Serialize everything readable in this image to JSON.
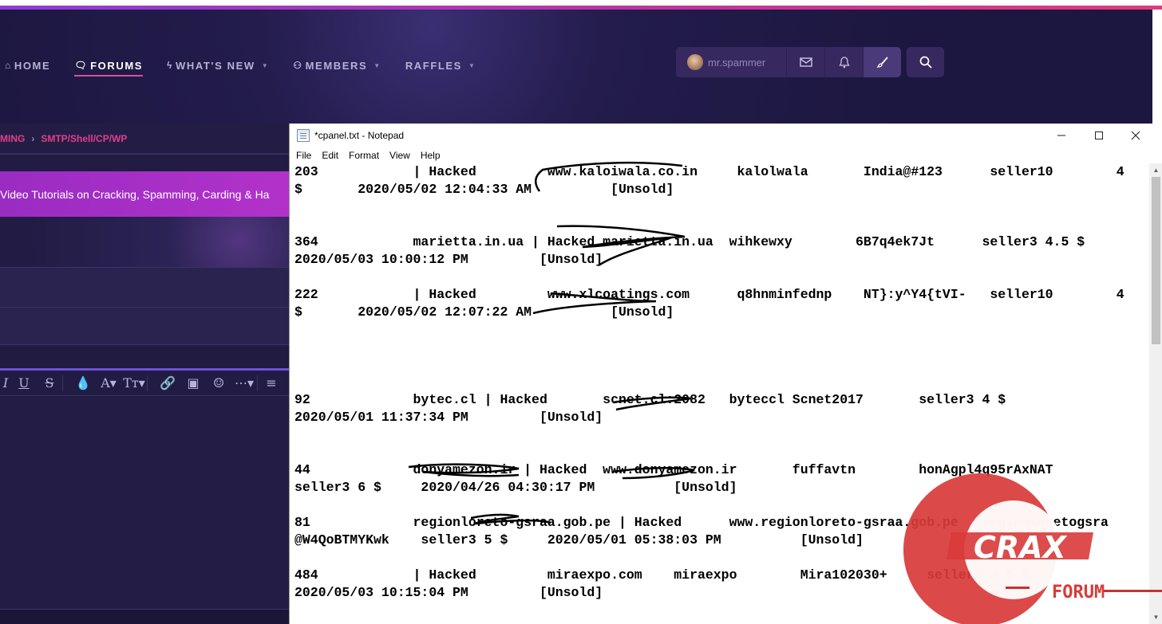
{
  "forum": {
    "nav": [
      {
        "label": "HOME",
        "icon": "home-icon"
      },
      {
        "label": "FORUMS",
        "icon": "forums-icon"
      },
      {
        "label": "WHAT'S NEW",
        "icon": "lightning-icon"
      },
      {
        "label": "MEMBERS",
        "icon": "members-icon"
      },
      {
        "label": "RAFFLES",
        "icon": ""
      }
    ],
    "username": "mr.spammer",
    "breadcrumb": [
      "MING",
      "SMTP/Shell/CP/WP"
    ],
    "banner_text": "Video Tutorials on Cracking, Spamming, Carding & Ha"
  },
  "notepad": {
    "title": "*cpanel.txt - Notepad",
    "menu": [
      "File",
      "Edit",
      "Format",
      "View",
      "Help"
    ],
    "lines": [
      "203            | Hacked         www.kaloiwala.co.in     kalolwala       India@#123      seller10        4",
      "$       2020/05/02 12:04:33 AM          [Unsold]",
      "",
      "",
      "364            marietta.in.ua | Hacked marietta.in.ua  wihkewxy        6B7q4ek7Jt      seller3 4.5 $",
      "2020/05/03 10:00:12 PM         [Unsold]",
      "",
      "222            | Hacked         www.xlcoatings.com      q8hnminfednp    NT}:y^Y4{tVI-   seller10        4",
      "$       2020/05/02 12:07:22 AM          [Unsold]",
      "",
      "",
      "",
      "",
      "92             bytec.cl | Hacked       scnet.cl:2082   byteccl Scnet2017       seller3 4 $",
      "2020/05/01 11:37:34 PM         [Unsold]",
      "",
      "",
      "44             donyamezon.ir | Hacked  www.donyamezon.ir       fuffavtn        honAgpl4q95rAxNAT",
      "seller3 6 $     2020/04/26 04:30:17 PM          [Unsold]",
      "",
      "81             regionloreto-gsraa.gob.pe | Hacked      www.regionloreto-gsraa.gob.pe   regionloretogsra",
      "@W4QoBTMYKwk    seller3 5 $     2020/05/01 05:38:03 PM          [Unsold]",
      "",
      "484            | Hacked         miraexpo.com    miraexpo        Mira102030+     seller3 4.5 $",
      "2020/05/03 10:15:04 PM         [Unsold]"
    ]
  },
  "watermark": {
    "brand": "CRAX",
    "sub": "FORUM"
  },
  "colors": {
    "accent": "#e0408a",
    "banner": "#a52fc6",
    "header_bg": "#231c4c",
    "watermark_red": "#d93a3a"
  }
}
